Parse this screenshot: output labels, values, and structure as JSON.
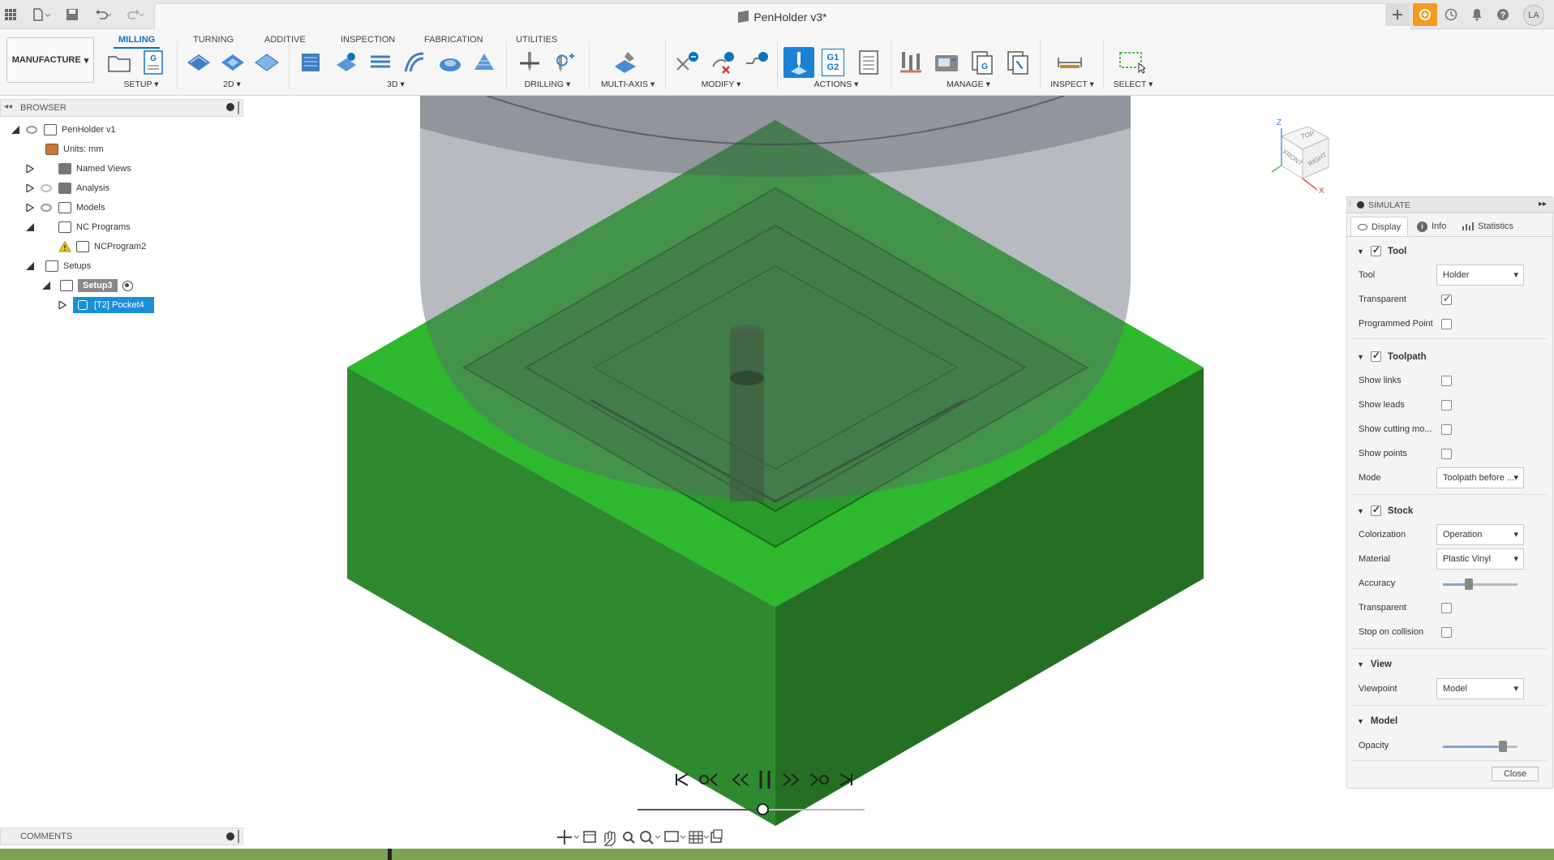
{
  "app": {
    "title": "PenHolder v3*",
    "user_initials": "LA"
  },
  "ribbon": {
    "workspace": "MANUFACTURE",
    "tabs": [
      "MILLING",
      "TURNING",
      "ADDITIVE",
      "INSPECTION",
      "FABRICATION",
      "UTILITIES"
    ],
    "active_tab": "MILLING",
    "groups": [
      "SETUP",
      "2D",
      "3D",
      "DRILLING",
      "MULTI-AXIS",
      "MODIFY",
      "ACTIONS",
      "MANAGE",
      "INSPECT",
      "SELECT"
    ],
    "actions_g1g2": [
      "G1",
      "G2"
    ]
  },
  "browser": {
    "title": "BROWSER",
    "items": [
      {
        "label": "PenHolder v1"
      },
      {
        "label": "Units: mm"
      },
      {
        "label": "Named Views"
      },
      {
        "label": "Analysis"
      },
      {
        "label": "Models"
      },
      {
        "label": "NC Programs"
      },
      {
        "label": "NCProgram2"
      },
      {
        "label": "Setups"
      },
      {
        "label": "Setup3"
      },
      {
        "label": "[T2] Pocket4"
      }
    ]
  },
  "comments": {
    "title": "COMMENTS"
  },
  "viewcube": {
    "faces": [
      "TOP",
      "FRONT",
      "RIGHT"
    ],
    "axes": [
      "Z",
      "X"
    ]
  },
  "simulate": {
    "title": "SIMULATE",
    "tabs": [
      "Display",
      "Info",
      "Statistics"
    ],
    "tool_section": {
      "title": "Tool",
      "tool_label": "Tool",
      "tool_value": "Holder",
      "transparent_label": "Transparent",
      "transparent": true,
      "programmed_point_label": "Programmed Point",
      "programmed_point": false
    },
    "toolpath_section": {
      "title": "Toolpath",
      "show_links_label": "Show links",
      "show_leads_label": "Show leads",
      "show_cutting_label": "Show cutting mo...",
      "show_points_label": "Show points",
      "mode_label": "Mode",
      "mode_value": "Toolpath before ..."
    },
    "stock_section": {
      "title": "Stock",
      "colorization_label": "Colorization",
      "colorization_value": "Operation",
      "material_label": "Material",
      "material_value": "Plastic Vinyl",
      "accuracy_label": "Accuracy",
      "accuracy_level": 0.35,
      "transparent_label": "Transparent",
      "stop_on_collision_label": "Stop on collision"
    },
    "view_section": {
      "title": "View",
      "viewpoint_label": "Viewpoint",
      "viewpoint_value": "Model"
    },
    "model_section": {
      "title": "Model",
      "opacity_label": "Opacity",
      "opacity_level": 0.8
    },
    "close_label": "Close"
  },
  "playback": {
    "progress": 0.55
  },
  "colors": {
    "accent": "#0c73c1",
    "stock_green": "#2db82d",
    "timeline": "#7aa354"
  }
}
